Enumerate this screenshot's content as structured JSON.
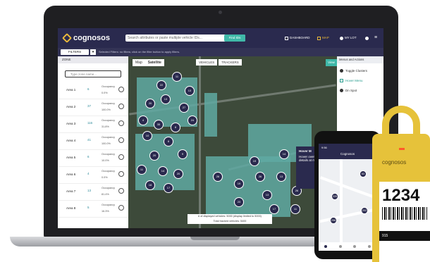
{
  "brand": {
    "name": "cognosos",
    "accent": "#e9b83b",
    "navy": "#2a2a4e",
    "teal": "#3fb8a8"
  },
  "topbar": {
    "search_placeholder": "Search attributes or paste multiple vehicle IDs...",
    "find_label": "Find IDs",
    "nav": [
      {
        "label": "DASHBOARD",
        "icon": "dashboard-icon"
      },
      {
        "label": "MAP",
        "icon": "map-icon",
        "active": true
      },
      {
        "label": "MY LOT",
        "icon": "pin-icon"
      }
    ]
  },
  "filterbar": {
    "filter_label": "FILTERS",
    "message": "Selected Filters: no filters; click on the filter button to apply filters."
  },
  "left": {
    "header": "ZONE",
    "search_placeholder": "Type zone name...",
    "areas": [
      {
        "name": "Area 1",
        "count": "6",
        "occ_label": "Occupancy",
        "pct": "0.0%"
      },
      {
        "name": "Area 2",
        "count": "37",
        "occ_label": "Occupancy",
        "pct": "100.0%"
      },
      {
        "name": "Area 3",
        "count": "116",
        "occ_label": "Occupancy",
        "pct": "31.8%"
      },
      {
        "name": "Area 4",
        "count": "41",
        "occ_label": "Occupancy",
        "pct": "100.0%"
      },
      {
        "name": "Area 5",
        "count": "6",
        "occ_label": "Occupancy",
        "pct": "10.0%"
      },
      {
        "name": "Area 6",
        "count": "4",
        "occ_label": "Occupancy",
        "pct": "0.0%"
      },
      {
        "name": "Area 7",
        "count": "13",
        "occ_label": "Occupancy",
        "pct": "81.4%"
      },
      {
        "name": "Area 8",
        "count": "5",
        "occ_label": "Occupancy",
        "pct": "16.3%"
      }
    ]
  },
  "map": {
    "tabs": [
      "Map",
      "Satellite"
    ],
    "buttons": [
      "VEHICLES",
      "TRACKERS"
    ],
    "view_label": "View",
    "clusters": [
      "22",
      "11",
      "13",
      "13",
      "20",
      "27",
      "4",
      "35",
      "8",
      "24",
      "10",
      "8",
      "20",
      "9",
      "11",
      "14",
      "20",
      "18",
      "17",
      "26",
      "19",
      "26",
      "13",
      "26",
      "13",
      "23",
      "17",
      "11",
      "14",
      "14",
      "19"
    ],
    "footer_line1": "# of displayed vehicles: 5000 (display limited to 5000)",
    "footer_line2": "Total tracked vehicles: 5400",
    "hover_title": "Hover M",
    "hover_text": "Hover over decks in lot details at mouse b"
  },
  "right": {
    "header": "Menus and Actions",
    "items": [
      {
        "label": "Toggle Clusters",
        "icon": "eye-icon"
      },
      {
        "label": "Hover Menu",
        "icon": "cursor-icon",
        "active": true
      },
      {
        "label": "Dn Spot",
        "icon": "pin-icon"
      }
    ]
  },
  "phone": {
    "time": "9:56",
    "title": "Cognosos",
    "clusters": [
      "63",
      "229",
      "202",
      "256"
    ]
  },
  "tag": {
    "brand": "cognosos",
    "number": "1234",
    "footer": "915"
  }
}
